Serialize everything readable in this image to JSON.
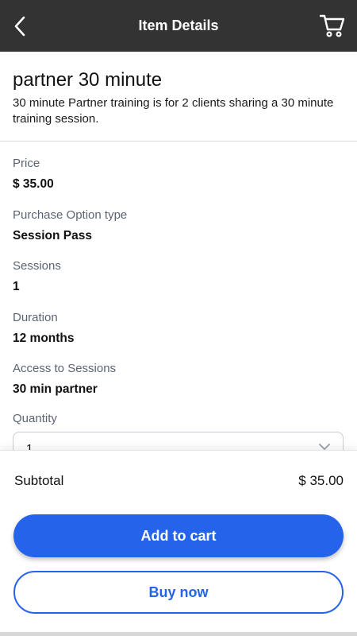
{
  "header": {
    "title": "Item Details",
    "back_icon": "chevron-left-icon",
    "cart_icon": "cart-icon"
  },
  "item": {
    "name": "partner 30 minute",
    "description": "30 minute Partner training is for 2 clients sharing a 30 minute training session."
  },
  "details": [
    {
      "label": "Price",
      "value": "$ 35.00"
    },
    {
      "label": "Purchase Option type",
      "value": "Session Pass"
    },
    {
      "label": "Sessions",
      "value": "1"
    },
    {
      "label": "Duration",
      "value": "12 months"
    },
    {
      "label": "Access to Sessions",
      "value": "30 min partner"
    }
  ],
  "quantity": {
    "label": "Quantity",
    "value": "1"
  },
  "footer": {
    "subtotal_label": "Subtotal",
    "subtotal_value": "$ 35.00",
    "add_to_cart_label": "Add to cart",
    "buy_now_label": "Buy now"
  },
  "colors": {
    "header_bg": "#333333",
    "accent": "#2563eb"
  }
}
